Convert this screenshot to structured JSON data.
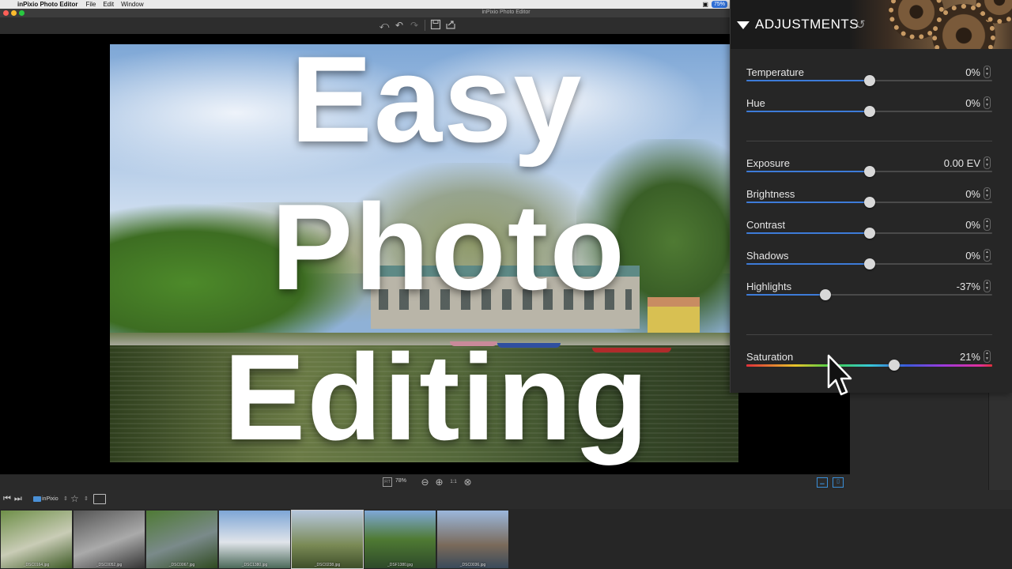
{
  "menubar": {
    "app_name": "inPixio Photo Editor",
    "menus": [
      "File",
      "Edit",
      "Window"
    ],
    "battery": "75%"
  },
  "window": {
    "title": "inPixio Photo Editor"
  },
  "toolbar": {
    "icons": [
      "undo-all-icon",
      "undo-icon",
      "redo-icon",
      "save-icon",
      "share-icon"
    ]
  },
  "overlay": {
    "line1": "Easy",
    "line2": "Photo",
    "line3": "Editing"
  },
  "zoombar": {
    "fit_label": "FIT",
    "zoom_percent": "78%",
    "one_to_one": "1:1"
  },
  "browser": {
    "folder_name": "inPixio",
    "thumbnails": [
      {
        "caption": "_DSC0164.jpg",
        "colors": [
          "#6e8f48",
          "#c9ccb6",
          "#3d5a25"
        ]
      },
      {
        "caption": "_DSC0052.jpg",
        "colors": [
          "#555",
          "#aaa",
          "#333"
        ]
      },
      {
        "caption": "_DSC0067.jpg",
        "colors": [
          "#4f7a35",
          "#7a8a8a",
          "#2f4a20"
        ]
      },
      {
        "caption": "_DSC1380.jpg",
        "colors": [
          "#7ea6d6",
          "#e0e4ea",
          "#4c6a5a"
        ]
      },
      {
        "caption": "_DSC0238.jpg",
        "colors": [
          "#b6c7de",
          "#7a8a55",
          "#3f4f2a"
        ]
      },
      {
        "caption": "_DSF1380.jpg",
        "colors": [
          "#7fa8d8",
          "#4f7a33",
          "#2e4a2a"
        ]
      },
      {
        "caption": "_DSC0036.jpg",
        "colors": [
          "#9bb7dc",
          "#7a6a5a",
          "#3a4a5a"
        ]
      }
    ]
  },
  "adjustments": {
    "title": "ADJUSTMENTS",
    "group1": [
      {
        "label": "Temperature",
        "value": "0%",
        "level": 0.5
      },
      {
        "label": "Hue",
        "value": "0%",
        "level": 0.5
      }
    ],
    "group2": [
      {
        "label": "Exposure",
        "value": "0.00 EV",
        "level": 0.5
      },
      {
        "label": "Brightness",
        "value": "0%",
        "level": 0.5
      },
      {
        "label": "Contrast",
        "value": "0%",
        "level": 0.5
      },
      {
        "label": "Shadows",
        "value": "0%",
        "level": 0.5
      },
      {
        "label": "Highlights",
        "value": "-37%",
        "level": 0.32
      }
    ],
    "saturation": {
      "label": "Saturation",
      "value": "21%",
      "level": 0.6
    }
  }
}
